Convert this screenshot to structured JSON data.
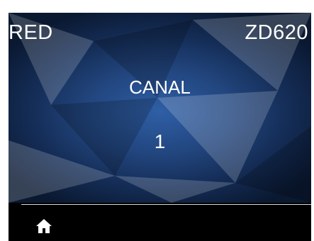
{
  "header": {
    "left_label": "RED",
    "right_label": "ZD620"
  },
  "content": {
    "title": "CANAL",
    "value": "1"
  },
  "footer": {
    "home_icon": "home-icon"
  },
  "colors": {
    "screen_bg": "#000000",
    "display_center": "#2f5fa6",
    "display_edge": "#0a1830",
    "text": "#ffffff",
    "divider": "#d9d9d9"
  }
}
